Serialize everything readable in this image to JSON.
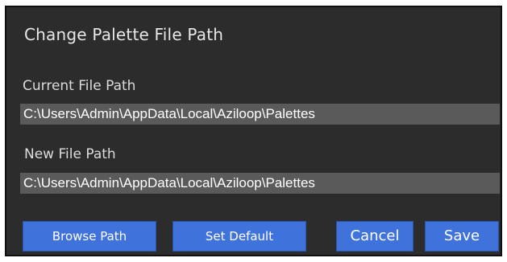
{
  "dialog": {
    "title": "Change Palette File Path"
  },
  "current": {
    "label": "Current File Path",
    "value": "C:\\Users\\Admin\\AppData\\Local\\Aziloop\\Palettes"
  },
  "new": {
    "label": "New File Path",
    "value": "C:\\Users\\Admin\\AppData\\Local\\Aziloop\\Palettes"
  },
  "buttons": {
    "browse": "Browse Path",
    "set_default": "Set Default",
    "cancel": "Cancel",
    "save": "Save"
  },
  "colors": {
    "dialog_bg": "#2c2c2c",
    "field_bg": "#5a5a5a",
    "button_bg": "#3f73db"
  }
}
